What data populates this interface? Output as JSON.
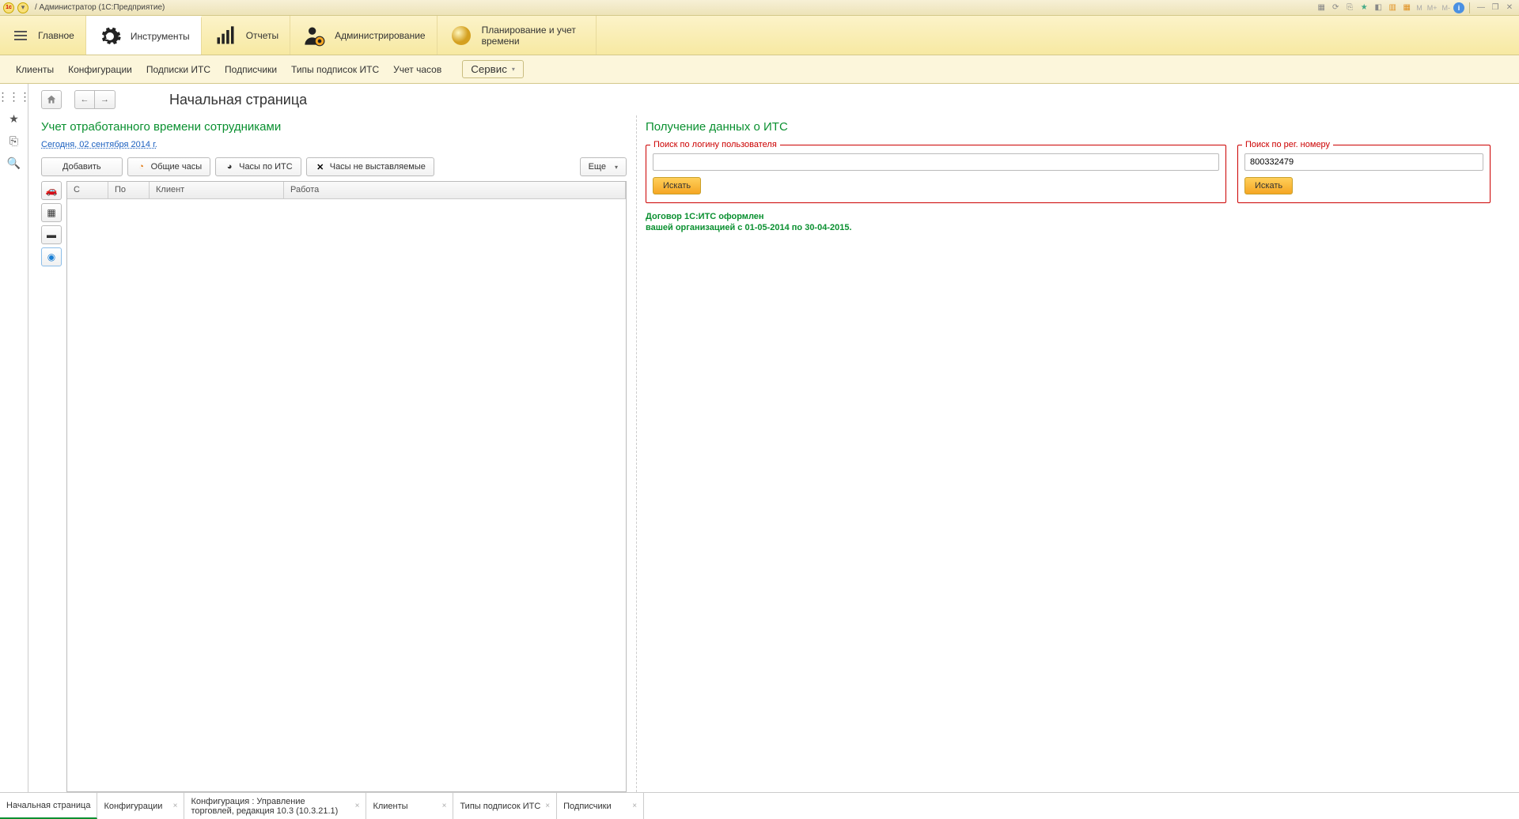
{
  "titlebar": {
    "app_title": "/ Администратор  (1С:Предприятие)",
    "m_items": [
      "M",
      "M+",
      "M-"
    ]
  },
  "sections": {
    "main": "Главное",
    "tools": "Инструменты",
    "reports": "Отчеты",
    "admin": "Администрирование",
    "planning": "Планирование и учет времени"
  },
  "subnav": {
    "clients": "Клиенты",
    "configs": "Конфигурации",
    "subscriptions_its": "Подписки ИТС",
    "subscribers": "Подписчики",
    "subscription_types": "Типы подписок ИТС",
    "hours": "Учет часов",
    "service": "Сервис"
  },
  "page": {
    "title": "Начальная страница"
  },
  "left_panel": {
    "title": "Учет отработанного времени сотрудниками",
    "date_link": "Сегодня, 02 сентября 2014 г.",
    "btn_add": "Добавить",
    "btn_common": "Общие часы",
    "btn_its": "Часы по ИТС",
    "btn_nonbill": "Часы не выставляемые",
    "btn_more": "Еще",
    "grid_headers": {
      "c": "С",
      "po": "По",
      "client": "Клиент",
      "work": "Работа"
    }
  },
  "right_panel": {
    "title": "Получение данных о ИТС",
    "search_login_label": "Поиск по логину пользователя",
    "search_login_value": "",
    "search_reg_label": "Поиск по рег. номеру",
    "search_reg_value": "800332479",
    "btn_search": "Искать",
    "contract_line1": "Договор 1С:ИТС оформлен",
    "contract_line2": "вашей организацией c 01-05-2014 по 30-04-2015."
  },
  "bottom_tabs": {
    "t1": "Начальная страница",
    "t2": "Конфигурации",
    "t3": "Конфигурация : Управление торговлей, редакция 10.3 (10.3.21.1)",
    "t4": "Клиенты",
    "t5": "Типы подписок ИТС",
    "t6": "Подписчики"
  }
}
